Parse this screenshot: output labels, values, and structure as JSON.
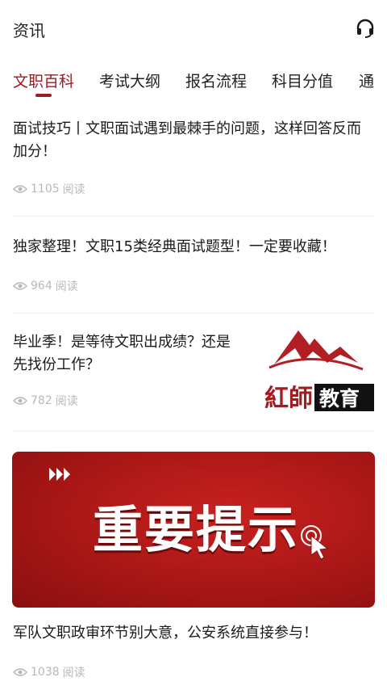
{
  "header": {
    "title": "资讯",
    "support_icon": "headset-icon"
  },
  "tabs": [
    {
      "label": "文职百科",
      "active": true
    },
    {
      "label": "考试大纲",
      "active": false
    },
    {
      "label": "报名流程",
      "active": false
    },
    {
      "label": "科目分值",
      "active": false
    },
    {
      "label": "通",
      "active": false
    }
  ],
  "articles": [
    {
      "title": "面试技巧丨文职面试遇到最棘手的问题，这样回答反而加分！",
      "views": "1105",
      "views_label": "阅读"
    },
    {
      "title": "独家整理！文职15类经典面试题型！一定要收藏！",
      "views": "964",
      "views_label": "阅读"
    },
    {
      "title": "毕业季！是等待文职出成绩？还是先找份工作？",
      "views": "782",
      "views_label": "阅读",
      "thumbnail": {
        "logo_text": "紅師教育"
      }
    },
    {
      "title": "军队文职政审环节别大意，公安系统直接参与！",
      "views": "1038",
      "views_label": "阅读",
      "banner": {
        "text": "重要提示"
      }
    }
  ],
  "colors": {
    "accent": "#9c1c22",
    "meta": "#b8b8b8",
    "banner": "#b31a19"
  }
}
